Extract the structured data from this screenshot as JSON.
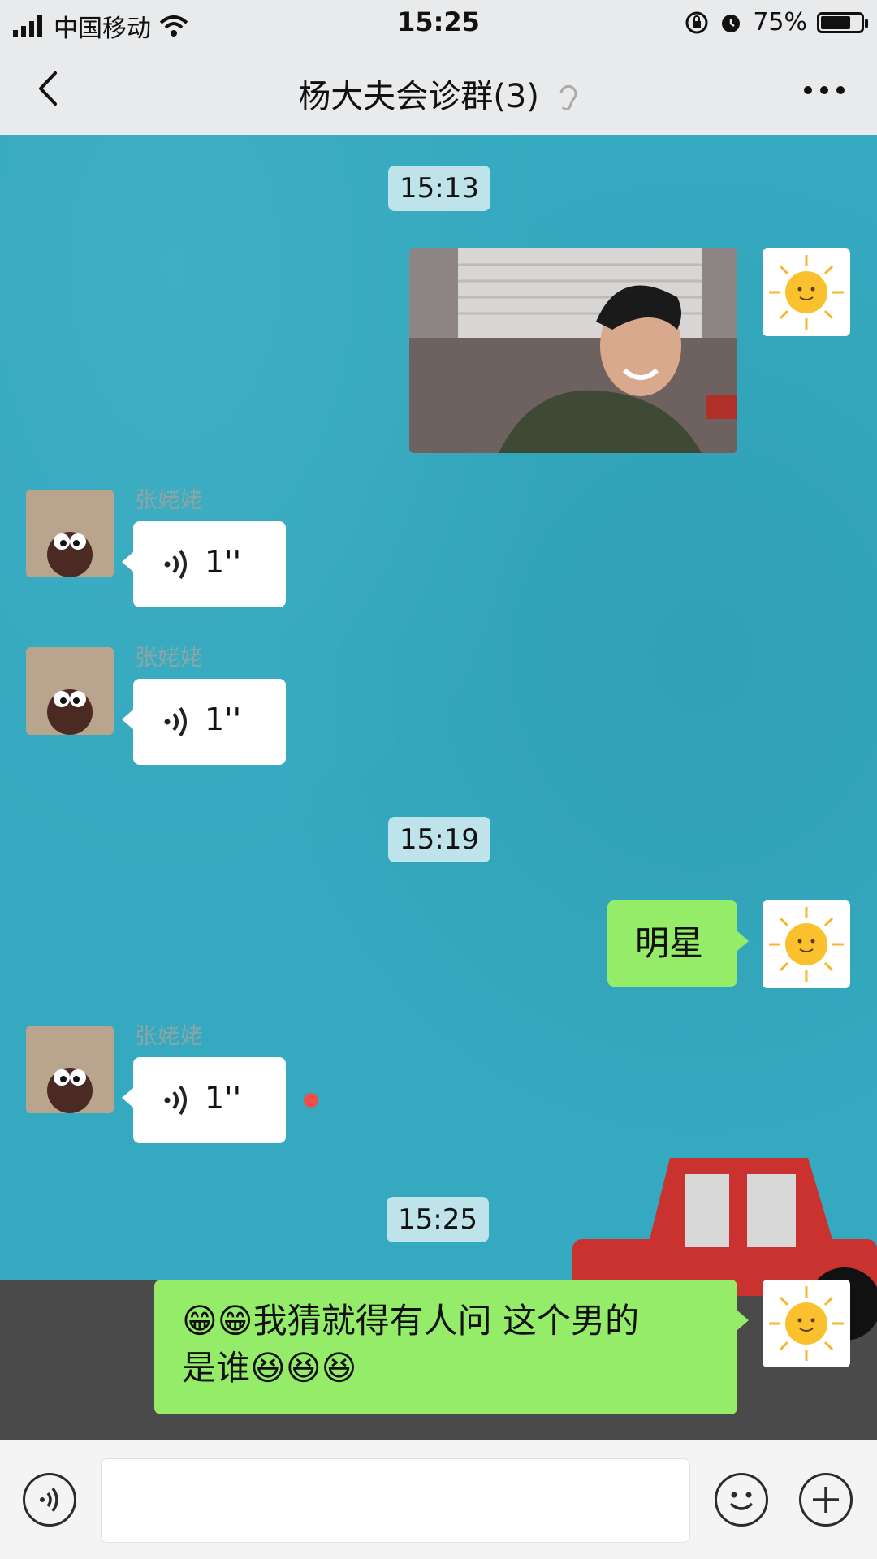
{
  "status_bar": {
    "carrier": "中国移动",
    "time": "15:25",
    "battery": "75%"
  },
  "nav": {
    "title": "杨大夫会诊群(3)"
  },
  "messages": [
    {
      "type": "timestamp",
      "text": "15:13"
    },
    {
      "type": "image",
      "from": "me",
      "image_alt": "smiling man photo"
    },
    {
      "type": "voice",
      "from": "张姥姥",
      "duration": "1''"
    },
    {
      "type": "voice",
      "from": "张姥姥",
      "duration": "1''"
    },
    {
      "type": "timestamp",
      "text": "15:19"
    },
    {
      "type": "text",
      "from": "me",
      "text": "明星"
    },
    {
      "type": "voice",
      "from": "张姥姥",
      "duration": "1''",
      "unread": true
    },
    {
      "type": "timestamp",
      "text": "15:25"
    },
    {
      "type": "text",
      "from": "me",
      "text_line1": "我猜就得有人问 这个男的",
      "text_line2": "是谁"
    }
  ]
}
